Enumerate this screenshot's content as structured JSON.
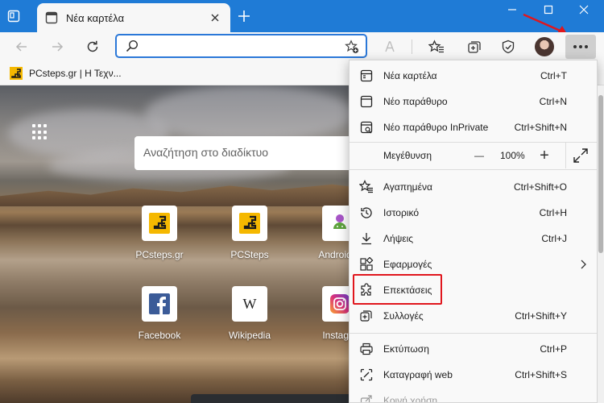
{
  "browser": {
    "tab": {
      "title": "Νέα καρτέλα"
    },
    "favorites_bar": {
      "item": "PCsteps.gr | Η Τεχν..."
    },
    "address_bar": {
      "value": ""
    }
  },
  "new_tab_page": {
    "search_placeholder": "Αναζήτηση στο διαδίκτυο",
    "tiles": [
      {
        "label": "PCsteps.gr",
        "icon": "pcsteps-logo-icon"
      },
      {
        "label": "PCSteps",
        "icon": "pcsteps-logo-icon"
      },
      {
        "label": "Android.C",
        "icon": "android-logo-icon"
      },
      {
        "label": "Facebook",
        "icon": "facebook-logo-icon"
      },
      {
        "label": "Wikipedia",
        "icon": "wikipedia-logo-icon"
      },
      {
        "label": "Instagra",
        "icon": "instagram-logo-icon"
      }
    ]
  },
  "menu": {
    "items": [
      {
        "label": "Νέα καρτέλα",
        "shortcut": "Ctrl+T",
        "icon": "new-tab-icon"
      },
      {
        "label": "Νέο παράθυρο",
        "shortcut": "Ctrl+N",
        "icon": "new-window-icon"
      },
      {
        "label": "Νέο παράθυρο InPrivate",
        "shortcut": "Ctrl+Shift+N",
        "icon": "inprivate-window-icon"
      }
    ],
    "zoom": {
      "label": "Μεγέθυνση",
      "value": "100%",
      "minus": "—",
      "plus": "+"
    },
    "items2": [
      {
        "label": "Αγαπημένα",
        "shortcut": "Ctrl+Shift+O",
        "icon": "favorites-icon"
      },
      {
        "label": "Ιστορικό",
        "shortcut": "Ctrl+H",
        "icon": "history-icon"
      },
      {
        "label": "Λήψεις",
        "shortcut": "Ctrl+J",
        "icon": "download-icon"
      },
      {
        "label": "Εφαρμογές",
        "shortcut": "",
        "icon": "apps-icon"
      },
      {
        "label": "Επεκτάσεις",
        "shortcut": "",
        "icon": "extensions-icon"
      },
      {
        "label": "Συλλογές",
        "shortcut": "Ctrl+Shift+Y",
        "icon": "collections-icon"
      }
    ],
    "items3": [
      {
        "label": "Εκτύπωση",
        "shortcut": "Ctrl+P",
        "icon": "print-icon"
      },
      {
        "label": "Καταγραφή web",
        "shortcut": "Ctrl+Shift+S",
        "icon": "web-capture-icon"
      },
      {
        "label": "Κοινή χρήση",
        "shortcut": "",
        "icon": "share-icon"
      }
    ]
  },
  "colors": {
    "titlebar": "#1f7bd6",
    "highlight": "#e0161d",
    "accent": "#2b78d8"
  }
}
